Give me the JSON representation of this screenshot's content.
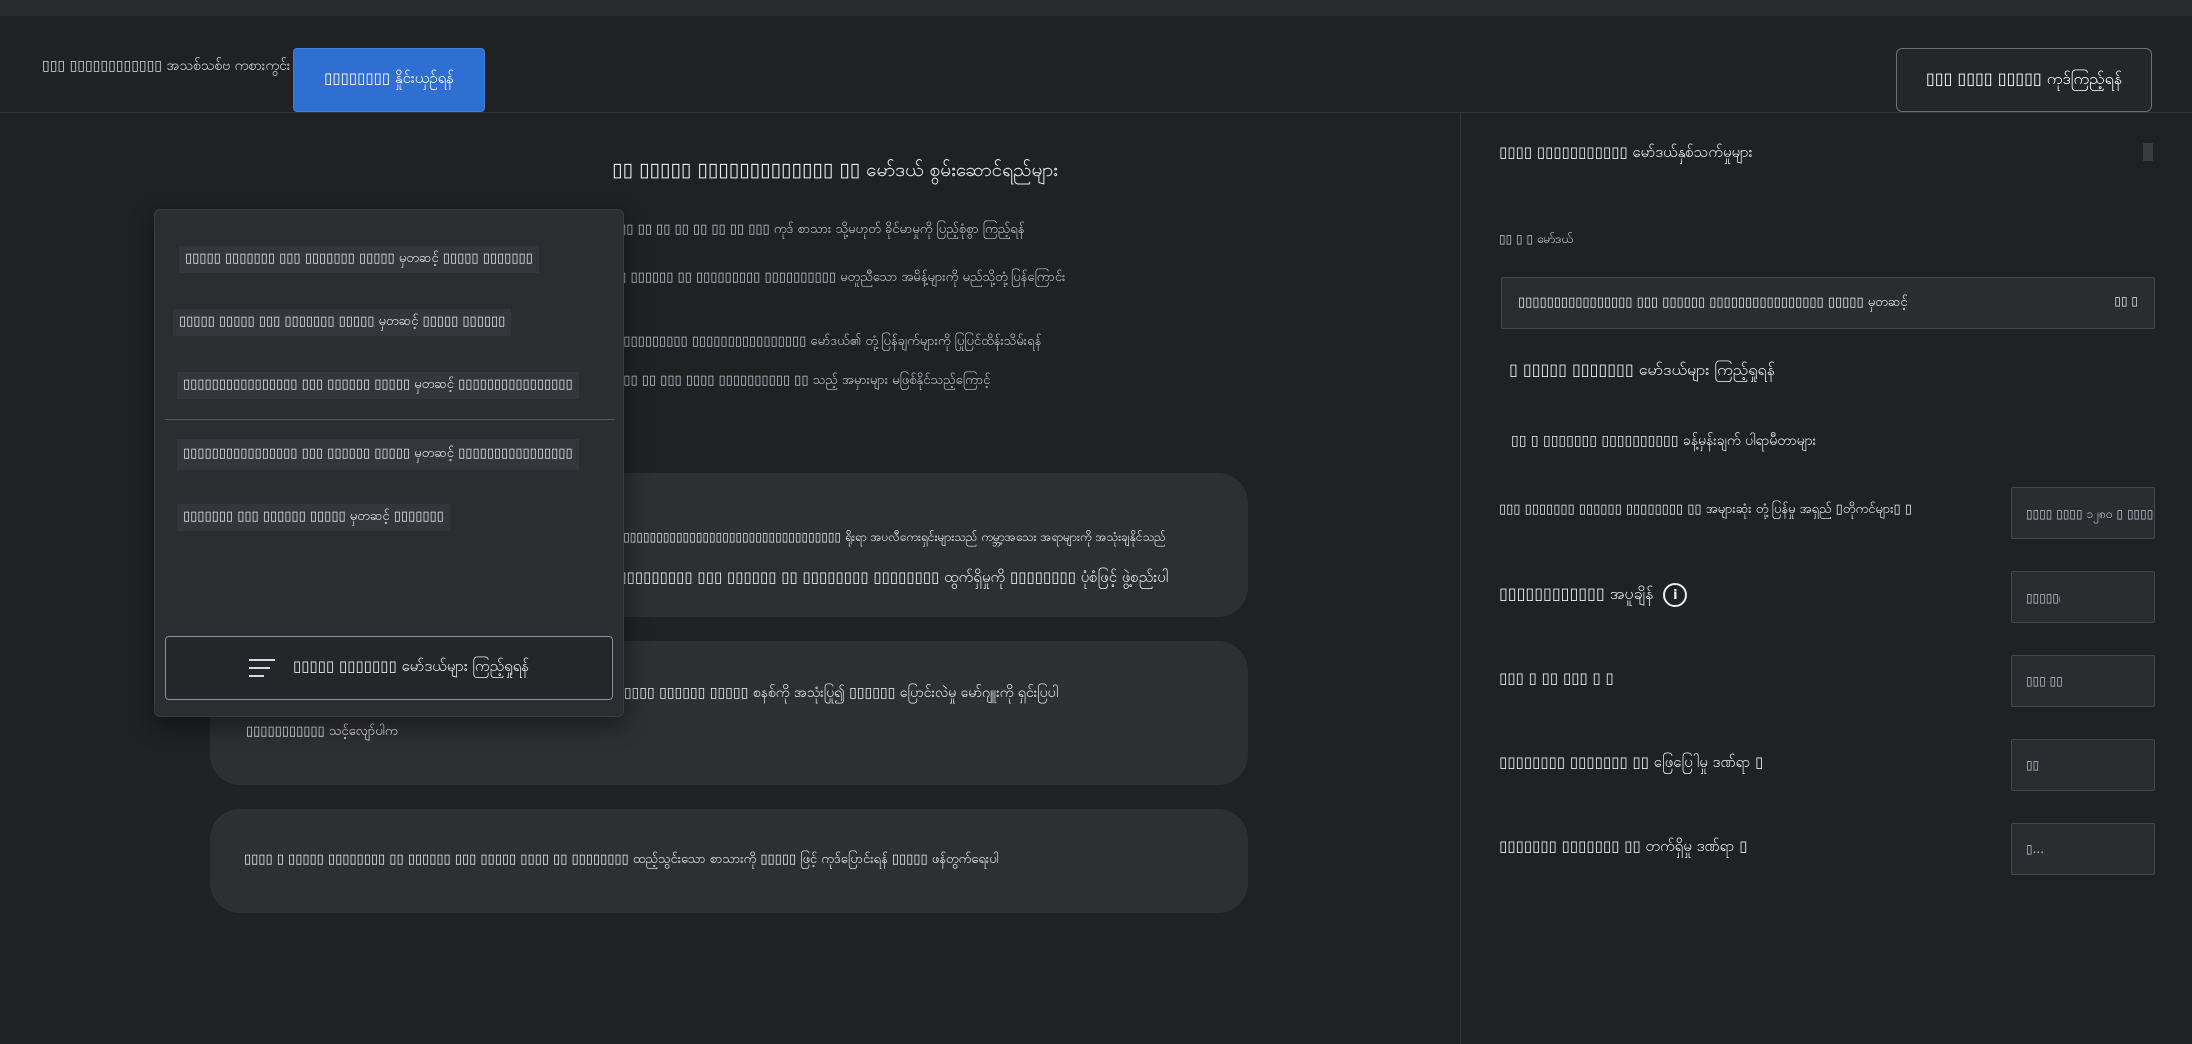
{
  "header": {
    "brand": "▯▯▯ ▯▯▯▯▯▯▯▯▯▯▯▯ အသစ်သစ်ဗ ကစားကွင်း",
    "compare_button": "▯▯▯▯▯▯▯▯ နှိုင်းယှဉ်ရန်",
    "view_code_button": "▯▯▯ ▯▯▯▯ ▯▯▯▯▯ ကုဒ်ကြည့်ရန်"
  },
  "main": {
    "title": "▯▯ ▯▯▯▯▯ ▯▯▯▯▯▯▯▯▯▯▯▯▯ ▯▯ မော်ဒယ် စွမ်းဆောင်ရည်များ",
    "lines": [
      "▯▯▯ ▯▯ ▯▯ ▯▯ ▯▯ ▯▯ ▯▯ ▯▯▯ ကုဒ် စာသား သို့မဟုတ် ခိုင်မာမှုကို ပြည့်စုံစွာ ကြည့်ရန်",
      "▯▯ ▯▯▯▯▯▯ ▯▯ ▯▯▯▯▯▯▯▯▯ ▯▯▯▯▯▯▯▯▯▯ မတူညီသော အမိန့်များကို မည်သို့တုံ့ပြန်ကြောင်း",
      "▯ ▯▯▯▯▯▯▯▯▯ ▯▯▯▯▯▯▯▯▯▯▯▯▯▯▯▯ မော်ဒယ်၏ တုံ့ပြန်ချက်များကို ပြုပြင်ထိန်းသိမ်းရန်",
      "▯ ▯▯ ▯▯ ▯▯▯ ▯▯▯▯ ▯▯▯▯▯▯▯▯▯▯ ▯▯ သည့် အမှားများ မဖြစ်နိုင်သည့်ကြောင့်"
    ]
  },
  "cards": [
    {
      "lines": [
        "▯▯▯▯▯▯▯▯▯▯▯▯▯▯▯▯▯▯▯▯▯▯▯▯▯▯▯▯▯▯▯▯▯▯▯ ရိုးရာ အပလီကေးရှင်းများသည် ကမ္ဘာ့အသေး အရာများကို အသုံးချနိုင်သည်",
        "▯▯▯▯▯▯▯▯▯▯ ▯▯▯ ▯▯▯▯▯▯ ▯▯ ▯▯▯▯▯▯▯▯ ▯▯▯▯▯▯▯▯ ထွက်ရှိမှုကို ▯▯▯▯▯▯▯▯ ပုံစံဖြင့် ဖွဲ့စည်းပါ"
      ]
    },
    {
      "lines": [
        "▯▯▯▯▯▯▯ ▯▯▯ ▯▯▯▯▯▯▯ ▯▯▯ ▯▯▯▯▯▯▯▯ ▯▯▯▯▯▯▯▯▯▯▯ ▯▯▯▯▯ ▯▯▯▯▯ ▯▯▯▯▯▯ ▯▯▯▯▯ စနစ်ကို အသုံးပြု၍ ▯▯▯▯▯▯ ပြောင်းလဲမှု မော်ဂျူးကို ရှင်းပြပါ",
        "▯▯▯▯▯▯▯▯▯▯▯ သင့်လျော်ပါက"
      ]
    },
    {
      "lines": [
        "▯▯▯▯ ▯ ▯▯▯▯▯ ▯▯▯▯▯▯▯▯ ▯▯ ▯▯▯▯▯▯ ▯▯▯ ▯▯▯▯▯ ▯▯▯▯ ▯▯ ▯▯▯▯▯▯▯▯ ထည့်သွင်းသော စာသားကို ▯▯▯▯▯ ဖြင့် ကုဒ်ပြောင်းရန် ▯▯▯▯▯ ဖန်တွက်ရေးပါ"
      ]
    }
  ],
  "dropdown": {
    "items": [
      "▯▯▯▯▯ ▯▯▯▯▯▯▯ ▯▯▯ ▯▯▯▯▯▯▯ ▯▯▯▯▯ မှတဆင့် ▯▯▯▯▯ ▯▯▯▯▯▯▯",
      "▯▯▯▯▯ ▯▯▯▯▯ ▯▯▯ ▯▯▯▯▯▯▯ ▯▯▯▯▯ မှတဆင့် ▯▯▯▯▯ ▯▯▯▯▯▯",
      "▯▯▯▯▯▯▯▯▯▯▯▯▯▯▯▯ ▯▯▯ ▯▯▯▯▯▯ ▯▯▯▯▯ မှတဆင့် ▯▯▯▯▯▯▯▯▯▯▯▯▯▯▯▯",
      "▯▯▯▯▯▯▯▯▯▯▯▯▯▯▯▯ ▯▯▯ ▯▯▯▯▯▯ ▯▯▯▯▯ မှတဆင့် ▯▯▯▯▯▯▯▯▯▯▯▯▯▯▯▯",
      "▯▯▯▯▯▯▯ ▯▯▯ ▯▯▯▯▯▯ ▯▯▯▯▯ မှတဆင့် ▯▯▯▯▯▯▯"
    ],
    "button_label": "▯▯▯▯▯ ▯▯▯▯▯▯▯ မော်ဒယ်များ ကြည့်ရှုရန်"
  },
  "panel": {
    "title": "▯▯▯▯ ▯▯▯▯▯▯▯▯▯▯▯ မော်ဒယ်နှစ်သက်မှုများ",
    "model_label": "▯▯ ▯ ▯ မော်ဒယ်",
    "model_value": "▯▯▯▯▯▯▯▯▯▯▯▯▯▯▯▯ ▯▯▯ ▯▯▯▯▯▯ ▯▯▯▯▯▯▯▯▯▯▯▯▯▯▯▯ ▯▯▯▯▯ မှတဆင့်",
    "model_chevron": "▯▯ ▯",
    "links": [
      "▯ ▯▯▯▯▯ ▯▯▯▯▯▯▯ မော်ဒယ်များ ကြည့်ရှုရန်",
      "▯▯ ▯ ▯▯▯▯▯▯▯ ▯▯▯▯▯▯▯▯▯▯ ခန့်မှန်းချက် ပါရာမီတာများ"
    ],
    "params": [
      {
        "label": "▯▯▯ ▯▯▯▯▯▯▯ ▯▯▯▯▯▯ ▯▯▯▯▯▯▯▯ ▯▯ အများဆုံး တုံ့ပြန်မှု အရှည် ▯တိုကင်များ▯ ▯",
        "value": "▯▯▯▯ ▯▯▯▯ ၁၂၈၀ ▯ ▯▯▯▯",
        "info": ""
      },
      {
        "label": "▯▯▯▯▯▯▯▯▯▯▯▯ အပူချိန်",
        "value": "▯▯▯▯▯၊",
        "info": "i"
      },
      {
        "label": "▯▯▯ ▯ ▯▯ ▯▯▯ ▯ ▯",
        "value": "▯▯▯ ▯▯",
        "info": ""
      },
      {
        "label": "▯▯▯▯▯▯▯▯ ▯▯▯▯▯▯▯ ▯▯ ဖြေပြေါမှု ဒဏ်ရာ ▯",
        "value": "▯▯",
        "info": ""
      },
      {
        "label": "▯▯▯▯▯▯▯ ▯▯▯▯▯▯▯ ▯▯ တက်ရှိမှု ဒဏ်ရာ ▯",
        "value": "▯...",
        "info": ""
      }
    ]
  }
}
